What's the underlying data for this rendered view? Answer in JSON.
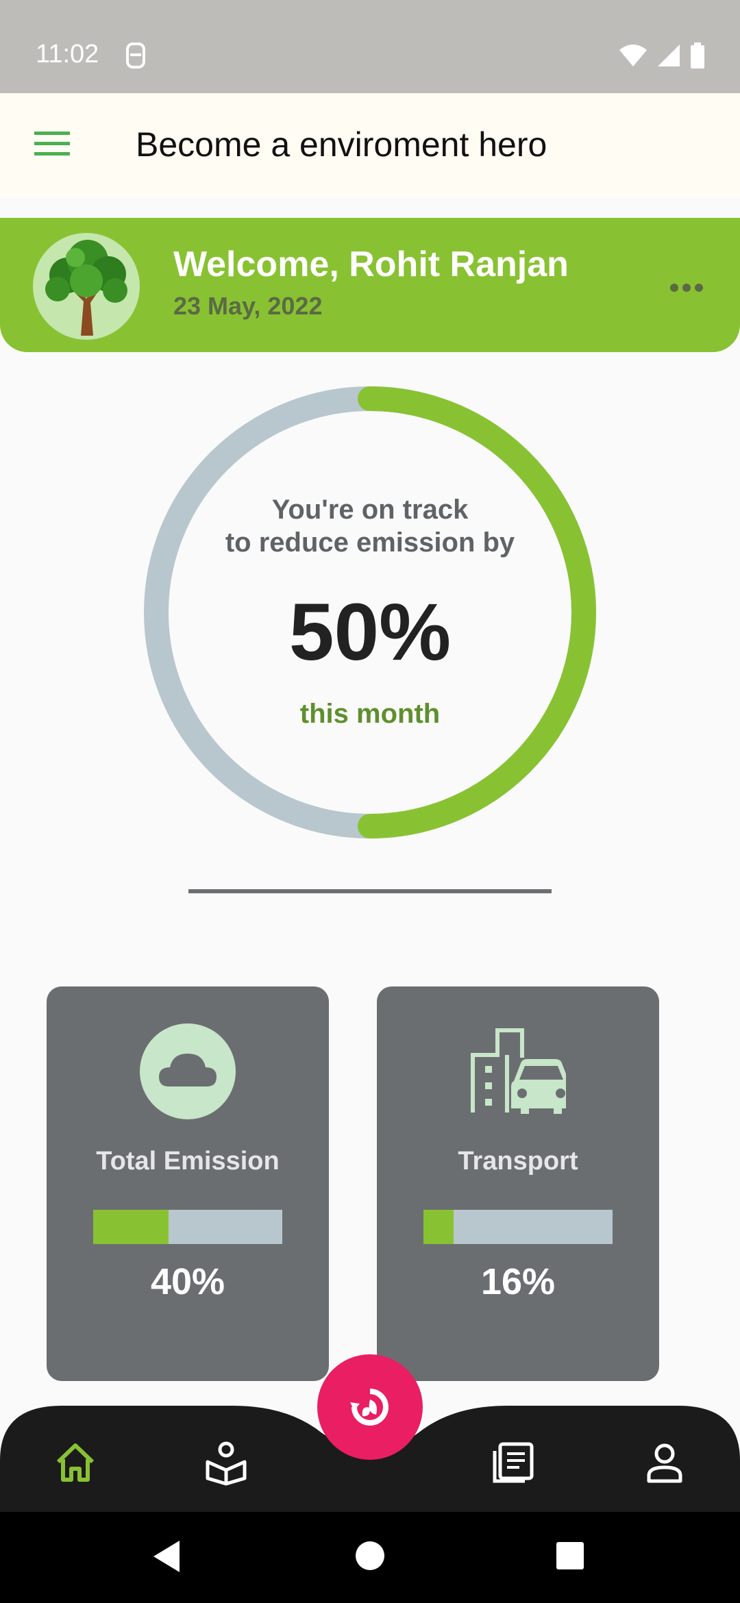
{
  "status_bar": {
    "time": "11:02"
  },
  "app_bar": {
    "title": "Become a enviroment hero"
  },
  "welcome": {
    "greeting": "Welcome, Rohit Ranjan",
    "date": "23 May, 2022"
  },
  "progress_ring": {
    "line1": "You're on track",
    "line2": "to reduce emission by",
    "value": "50%",
    "caption": "this month",
    "fraction": 0.5
  },
  "stats": [
    {
      "label": "Total Emission",
      "value": "40%",
      "fraction": 0.4,
      "icon": "cloud-icon"
    },
    {
      "label": "Transport",
      "value": "16%",
      "fraction": 0.16,
      "icon": "city-car-icon"
    }
  ],
  "bottom_nav": {
    "items": [
      "home-icon",
      "reading-icon",
      "news-icon",
      "profile-icon"
    ],
    "fab_icon": "recycle-leaf-icon"
  },
  "colors": {
    "accent_green": "#88c232",
    "track_gray": "#b8c7cd",
    "fab_pink": "#e91e63",
    "card_gray": "#6b6e71"
  }
}
